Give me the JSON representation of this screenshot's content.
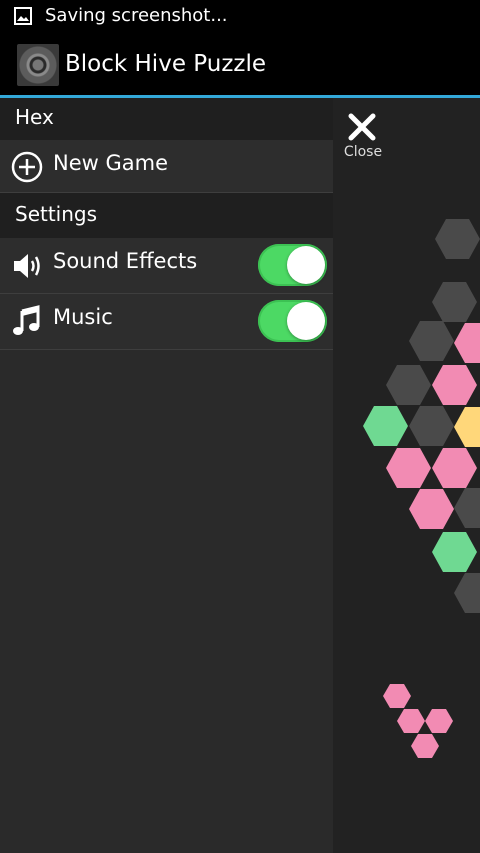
{
  "status_bar": {
    "text": "Saving screenshot...",
    "icon": "image-icon"
  },
  "app_bar": {
    "title": "Block Hive Puzzle",
    "logo_icon": "app-logo-icon"
  },
  "drawer": {
    "section_game": "Hex",
    "new_game_label": "New Game",
    "section_settings": "Settings",
    "sound_effects_label": "Sound Effects",
    "music_label": "Music",
    "sound_effects_on": true,
    "music_on": true
  },
  "game": {
    "close_label": "Close",
    "colors": {
      "empty": "#4a4a4a",
      "pink": "#f28bb3",
      "green": "#6fd992",
      "yellow": "#ffd77a"
    }
  },
  "colors": {
    "accent_line": "#33a8d9",
    "toggle_on": "#4cd964",
    "drawer_bg": "#2a2a2a",
    "game_bg": "#222222"
  }
}
